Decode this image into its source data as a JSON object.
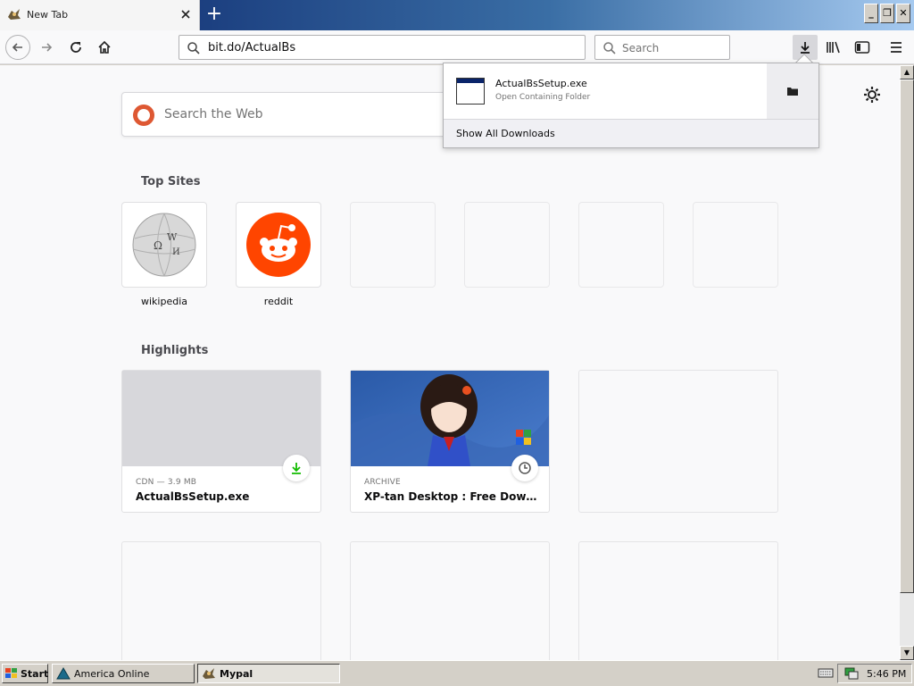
{
  "tab": {
    "title": "New Tab"
  },
  "window": {
    "minimize": "_",
    "restore": "❐",
    "close": "✕"
  },
  "navbar": {
    "url": "bit.do/ActualBs",
    "search_placeholder": "Search"
  },
  "newtab": {
    "search_placeholder": "Search the Web",
    "top_sites_heading": "Top Sites",
    "highlights_heading": "Highlights",
    "top_sites": [
      {
        "label": "wikipedia"
      },
      {
        "label": "reddit"
      }
    ],
    "highlights": [
      {
        "meta": "CDN — 3.9 MB",
        "title": "ActualBsSetup.exe",
        "badge": "download-icon"
      },
      {
        "meta": "ARCHIVE",
        "title": "XP-tan Desktop : Free Download...",
        "badge": "clock-icon"
      }
    ]
  },
  "downloads_panel": {
    "file_name": "ActualBsSetup.exe",
    "file_action": "Open Containing Folder",
    "show_all": "Show All Downloads"
  },
  "taskbar": {
    "start": "Start",
    "tasks": [
      {
        "label": "America  Online",
        "active": false
      },
      {
        "label": "Mypal",
        "active": true
      }
    ],
    "clock": "5:46 PM"
  },
  "colors": {
    "reddit": "#ff4500",
    "download_green": "#12bc00",
    "titlebar_blue": "#0a246a"
  }
}
